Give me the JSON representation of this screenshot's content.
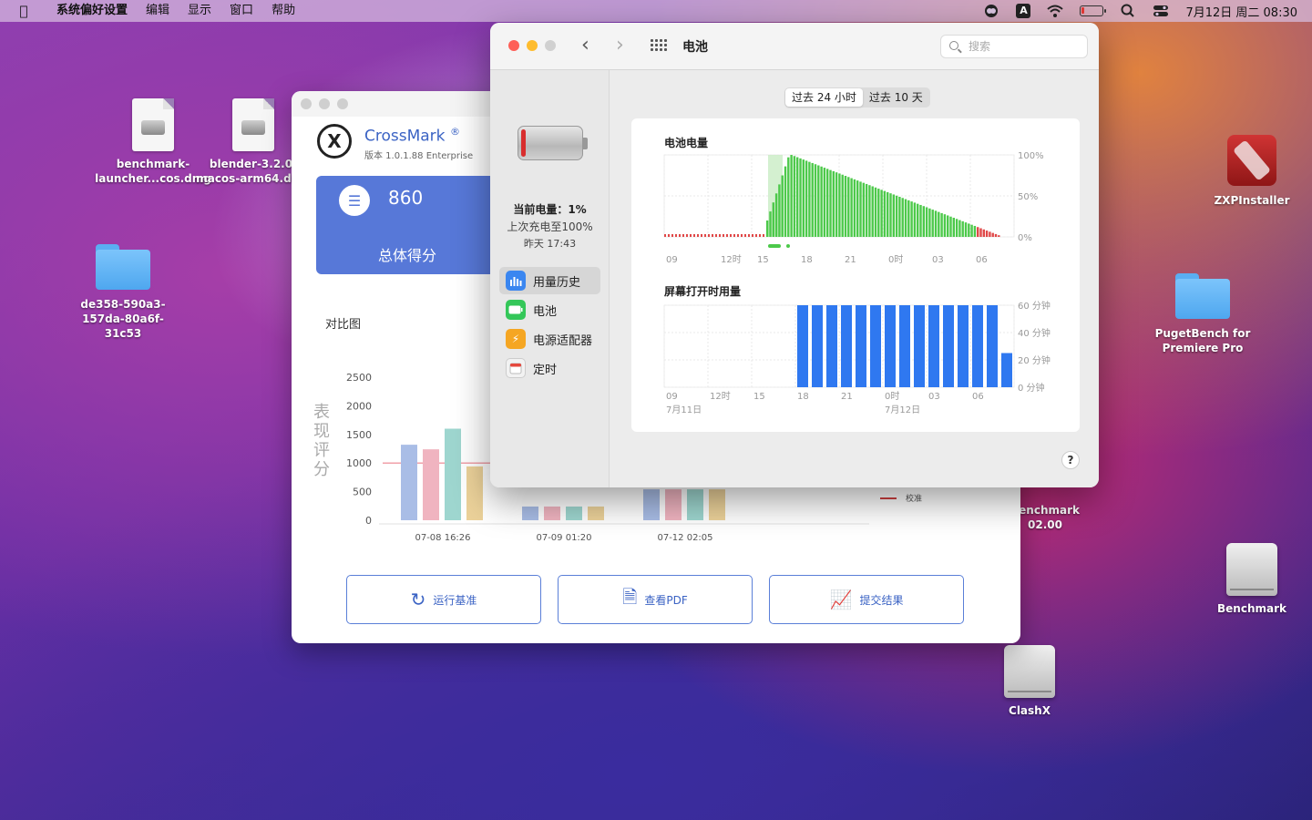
{
  "menubar": {
    "app_name": "系统偏好设置",
    "items": [
      "编辑",
      "显示",
      "窗口",
      "帮助"
    ],
    "input_source": "A",
    "clock": "7月12日 周二 08:30"
  },
  "desktop_icons": [
    {
      "id": "benchmark-launcher",
      "label": "benchmark-launcher...cos.dmg",
      "type": "dmg"
    },
    {
      "id": "blender",
      "label": "blender-3.2.0-macos-arm64.dmg",
      "type": "dmg"
    },
    {
      "id": "folder-de358",
      "label": "de358-590a3-157da-80a6f-31c53",
      "type": "folder"
    },
    {
      "id": "zxpinstaller",
      "label": "ZXPInstaller",
      "type": "app"
    },
    {
      "id": "pugetbench",
      "label": "PugetBench for Premiere Pro",
      "type": "folder"
    },
    {
      "id": "benchmark-partial",
      "label": "Benchmark 02.00",
      "type": "drive"
    },
    {
      "id": "benchmark",
      "label": "Benchmark",
      "type": "drive"
    },
    {
      "id": "clashx",
      "label": "ClashX",
      "type": "drive"
    }
  ],
  "crossmark": {
    "name": "CrossMark",
    "registered": "®",
    "version": "版本 1.0.1.88 Enterprise",
    "score": "860",
    "score_label": "总体得分",
    "compare_title": "对比图",
    "ylabel": "表现评分",
    "legend_label": "校准",
    "buttons": {
      "run": "运行基准",
      "pdf": "查看PDF",
      "submit": "提交结果"
    }
  },
  "chart_data": [
    {
      "type": "bar",
      "title": "",
      "ylabel": "表现评分",
      "ylim": [
        0,
        2500
      ],
      "yticks": [
        0,
        500,
        1000,
        1500,
        2000,
        2500
      ],
      "categories": [
        "07-08 16:26",
        "07-09 01:20",
        "07-12 02:05"
      ],
      "series_colors": [
        "#a9bde6",
        "#f0b4c0",
        "#9ed6cf",
        "#ecd29a"
      ],
      "series": [
        {
          "values": [
            1320,
            240,
            540
          ]
        },
        {
          "values": [
            1240,
            240,
            540
          ]
        },
        {
          "values": [
            1600,
            240,
            540
          ]
        },
        {
          "values": [
            940,
            240,
            540
          ]
        }
      ],
      "reference_line": {
        "label": "校准",
        "value": 1000
      }
    },
    {
      "type": "bar",
      "title": "电池电量",
      "yticks": [
        "0%",
        "50%",
        "100%"
      ],
      "ylim": [
        0,
        100
      ],
      "xticks": [
        "09",
        "12时",
        "15",
        "18",
        "21",
        "0时",
        "03",
        "06"
      ],
      "low_level_hours": "09 – 15",
      "charging_window": [
        "15",
        "16"
      ],
      "peak_level": 100,
      "end_level": 1
    },
    {
      "type": "bar",
      "title": "屏幕打开时用量",
      "yticks": [
        "0 分钟",
        "20 分钟",
        "40 分钟",
        "60 分钟"
      ],
      "ylim": [
        0,
        60
      ],
      "xticks": [
        "09",
        "12时",
        "15",
        "18",
        "21",
        "0时",
        "03",
        "06"
      ],
      "date_labels": [
        "7月11日",
        "7月12日"
      ],
      "values": [
        60,
        60,
        60,
        60,
        60,
        60,
        60,
        60,
        60,
        60,
        60,
        60,
        60,
        60,
        25
      ],
      "bar_color": "#2f78f0"
    }
  ],
  "battery": {
    "title": "电池",
    "search_placeholder": "搜索",
    "current": "当前电量：1%",
    "last_charge": "上次充电至100%",
    "last_charge_time": "昨天 17:43",
    "sidebar": [
      {
        "label": "用量历史",
        "icon": "chart-icon",
        "color": "#3a86f0",
        "active": true
      },
      {
        "label": "电池",
        "icon": "battery-icon",
        "color": "#34c759",
        "active": false
      },
      {
        "label": "电源适配器",
        "icon": "lightning-icon",
        "color": "#f5a623",
        "active": false
      },
      {
        "label": "定时",
        "icon": "calendar-icon",
        "color": "#e8e8e8",
        "active": false
      }
    ],
    "segments": [
      "过去 24 小时",
      "过去 10 天"
    ],
    "help": "?"
  }
}
